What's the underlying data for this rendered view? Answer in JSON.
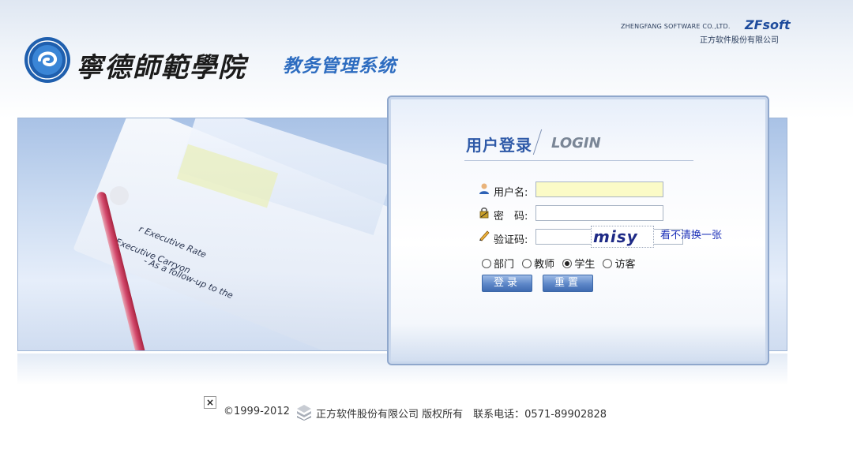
{
  "header": {
    "school_name": "寧德師範學院",
    "system_name": "教务管理系统",
    "vendor_english": "ZHENGFANG SOFTWARE CO.,LTD.",
    "vendor_brand": "ZFsoft",
    "vendor_chinese": "正方软件股份有限公司"
  },
  "banner": {
    "paper_text_1": "r Executive Rate",
    "paper_text_2": "Executive Carryon",
    "paper_text_3": "- As a follow-up to the"
  },
  "login": {
    "title": "用户登录",
    "title_en": "LOGIN",
    "username_label": "用户名:",
    "username_value": "",
    "password_label": "密　码:",
    "password_value": "",
    "captcha_label": "验证码:",
    "captcha_value": "",
    "captcha_image_text": "misy",
    "refresh_captcha_link": "看不清换一张",
    "roles": [
      {
        "label": "部门",
        "selected": false
      },
      {
        "label": "教师",
        "selected": false
      },
      {
        "label": "学生",
        "selected": true
      },
      {
        "label": "访客",
        "selected": false
      }
    ],
    "login_button": "登录",
    "reset_button": "重置"
  },
  "footer": {
    "copyright": "©1999-2012",
    "company": "正方软件股份有限公司 版权所有　联系电话：0571-89902828"
  },
  "colors": {
    "accent_blue": "#2d6cc0",
    "title_blue": "#2f5aa8",
    "link_blue": "#1b2fb8",
    "input_highlight": "#fbfbc7"
  },
  "icons": {
    "username": "user-icon",
    "password": "lock-icon",
    "captcha": "pencil-icon",
    "broken_image": "broken-image-icon"
  }
}
